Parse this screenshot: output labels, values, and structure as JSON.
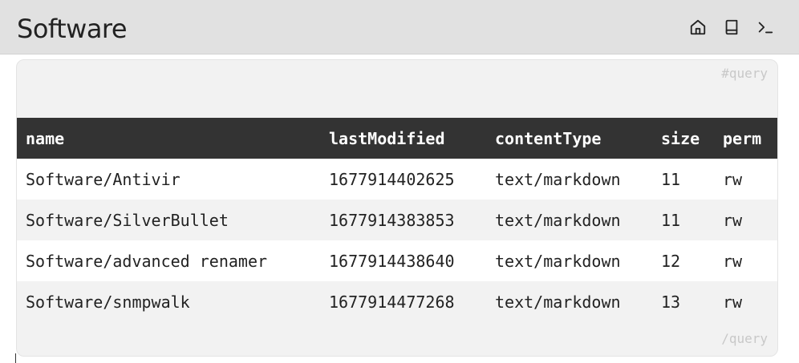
{
  "header": {
    "title": "Software",
    "actions": [
      {
        "name": "home-icon",
        "label": "Home"
      },
      {
        "name": "book-icon",
        "label": "Index"
      },
      {
        "name": "terminal-icon",
        "label": "Command palette"
      }
    ]
  },
  "query": {
    "open_marker": "#query",
    "close_marker": "/query",
    "columns": [
      "name",
      "lastModified",
      "contentType",
      "size",
      "perm"
    ],
    "rows": [
      [
        "Software/Antivir",
        "1677914402625",
        "text/markdown",
        "11",
        "rw"
      ],
      [
        "Software/SilverBullet",
        "1677914383853",
        "text/markdown",
        "11",
        "rw"
      ],
      [
        "Software/advanced renamer",
        "1677914438640",
        "text/markdown",
        "12",
        "rw"
      ],
      [
        "Software/snmpwalk",
        "1677914477268",
        "text/markdown",
        "13",
        "rw"
      ]
    ]
  },
  "colors": {
    "topbar_bg": "#e1e1e1",
    "table_header_bg": "#333333",
    "block_bg": "#f2f2f2"
  }
}
